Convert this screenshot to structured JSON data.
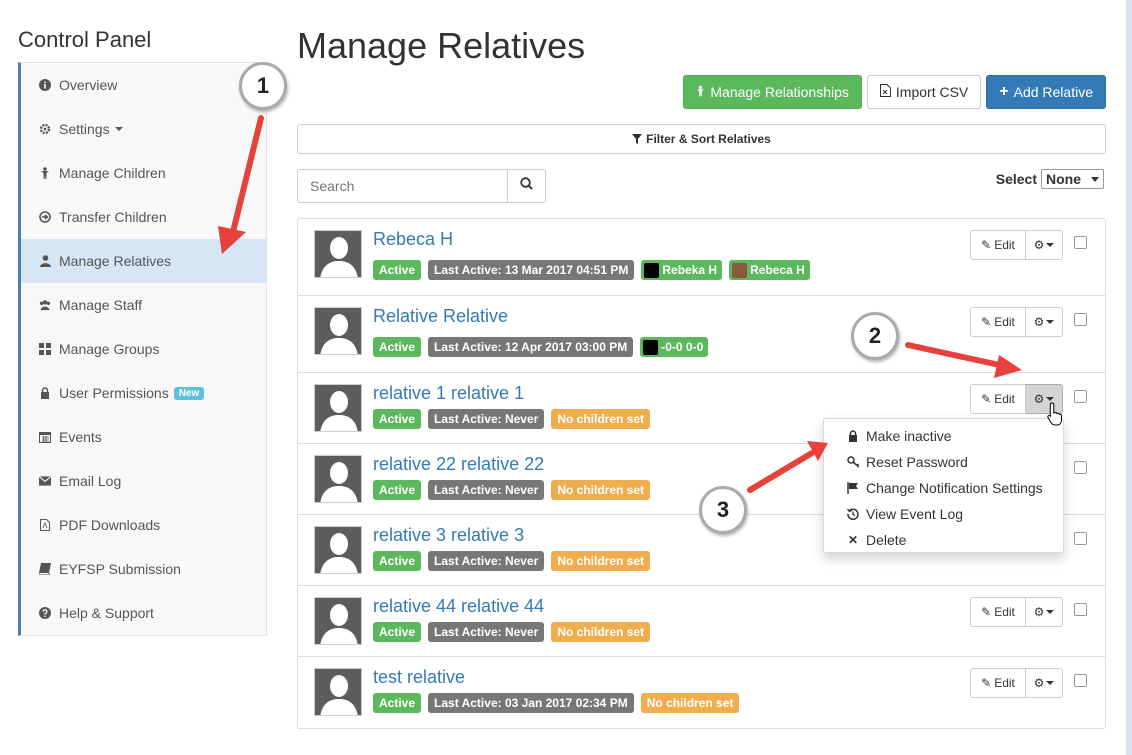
{
  "sidebar": {
    "title": "Control Panel",
    "items": [
      {
        "label": "Overview",
        "icon": "info-icon"
      },
      {
        "label": "Settings",
        "icon": "cog-icon"
      },
      {
        "label": "Manage Children",
        "icon": "child-icon"
      },
      {
        "label": "Transfer Children",
        "icon": "transfer-icon"
      },
      {
        "label": "Manage Relatives",
        "icon": "user-icon",
        "active": true
      },
      {
        "label": "Manage Staff",
        "icon": "users-icon"
      },
      {
        "label": "Manage Groups",
        "icon": "grid-icon"
      },
      {
        "label": "User Permissions",
        "icon": "lock-icon",
        "badge": "New"
      },
      {
        "label": "Events",
        "icon": "calendar-icon"
      },
      {
        "label": "Email Log",
        "icon": "envelope-icon"
      },
      {
        "label": "PDF Downloads",
        "icon": "pdf-icon"
      },
      {
        "label": "EYFSP Submission",
        "icon": "book-icon"
      },
      {
        "label": "Help & Support",
        "icon": "help-icon"
      }
    ]
  },
  "main": {
    "title": "Manage Relatives",
    "buttons": {
      "manage_relationships": "Manage Relationships",
      "import_csv": "Import CSV",
      "add_relative": "Add Relative"
    },
    "filter_label": "Filter & Sort Relatives",
    "search_placeholder": "Search",
    "select_label": "Select",
    "select_value": "None"
  },
  "relatives": [
    {
      "name": "Rebeca H",
      "status": "Active",
      "last_active": "Last Active: 13 Mar 2017 04:51 PM",
      "children": [
        "Rebeka H",
        "Rebeca H"
      ]
    },
    {
      "name": "Relative Relative",
      "status": "Active",
      "last_active": "Last Active: 12 Apr 2017 03:00 PM",
      "children": [
        "-0-0 0-0"
      ]
    },
    {
      "name": "relative 1 relative 1",
      "status": "Active",
      "last_active": "Last Active: Never",
      "no_children": "No children set"
    },
    {
      "name": "relative 22 relative 22",
      "status": "Active",
      "last_active": "Last Active: Never",
      "no_children": "No children set"
    },
    {
      "name": "relative 3 relative 3",
      "status": "Active",
      "last_active": "Last Active: Never",
      "no_children": "No children set"
    },
    {
      "name": "relative 44 relative 44",
      "status": "Active",
      "last_active": "Last Active: Never",
      "no_children": "No children set"
    },
    {
      "name": "test relative",
      "status": "Active",
      "last_active": "Last Active: 03 Jan 2017 02:34 PM",
      "no_children": "No children set"
    }
  ],
  "row_actions": {
    "edit_label": "Edit"
  },
  "dropdown": {
    "items": [
      {
        "label": "Make inactive",
        "icon": "lock-icon"
      },
      {
        "label": "Reset Password",
        "icon": "key-icon"
      },
      {
        "label": "Change Notification Settings",
        "icon": "flag-icon"
      },
      {
        "label": "View Event Log",
        "icon": "history-icon"
      },
      {
        "label": "Delete",
        "icon": "times-icon"
      }
    ]
  },
  "callouts": [
    "1",
    "2",
    "3"
  ],
  "colors": {
    "accent_red": "#e8403a",
    "primary": "#337ab7",
    "success": "#5cb85c",
    "warning": "#f0ad4e"
  }
}
